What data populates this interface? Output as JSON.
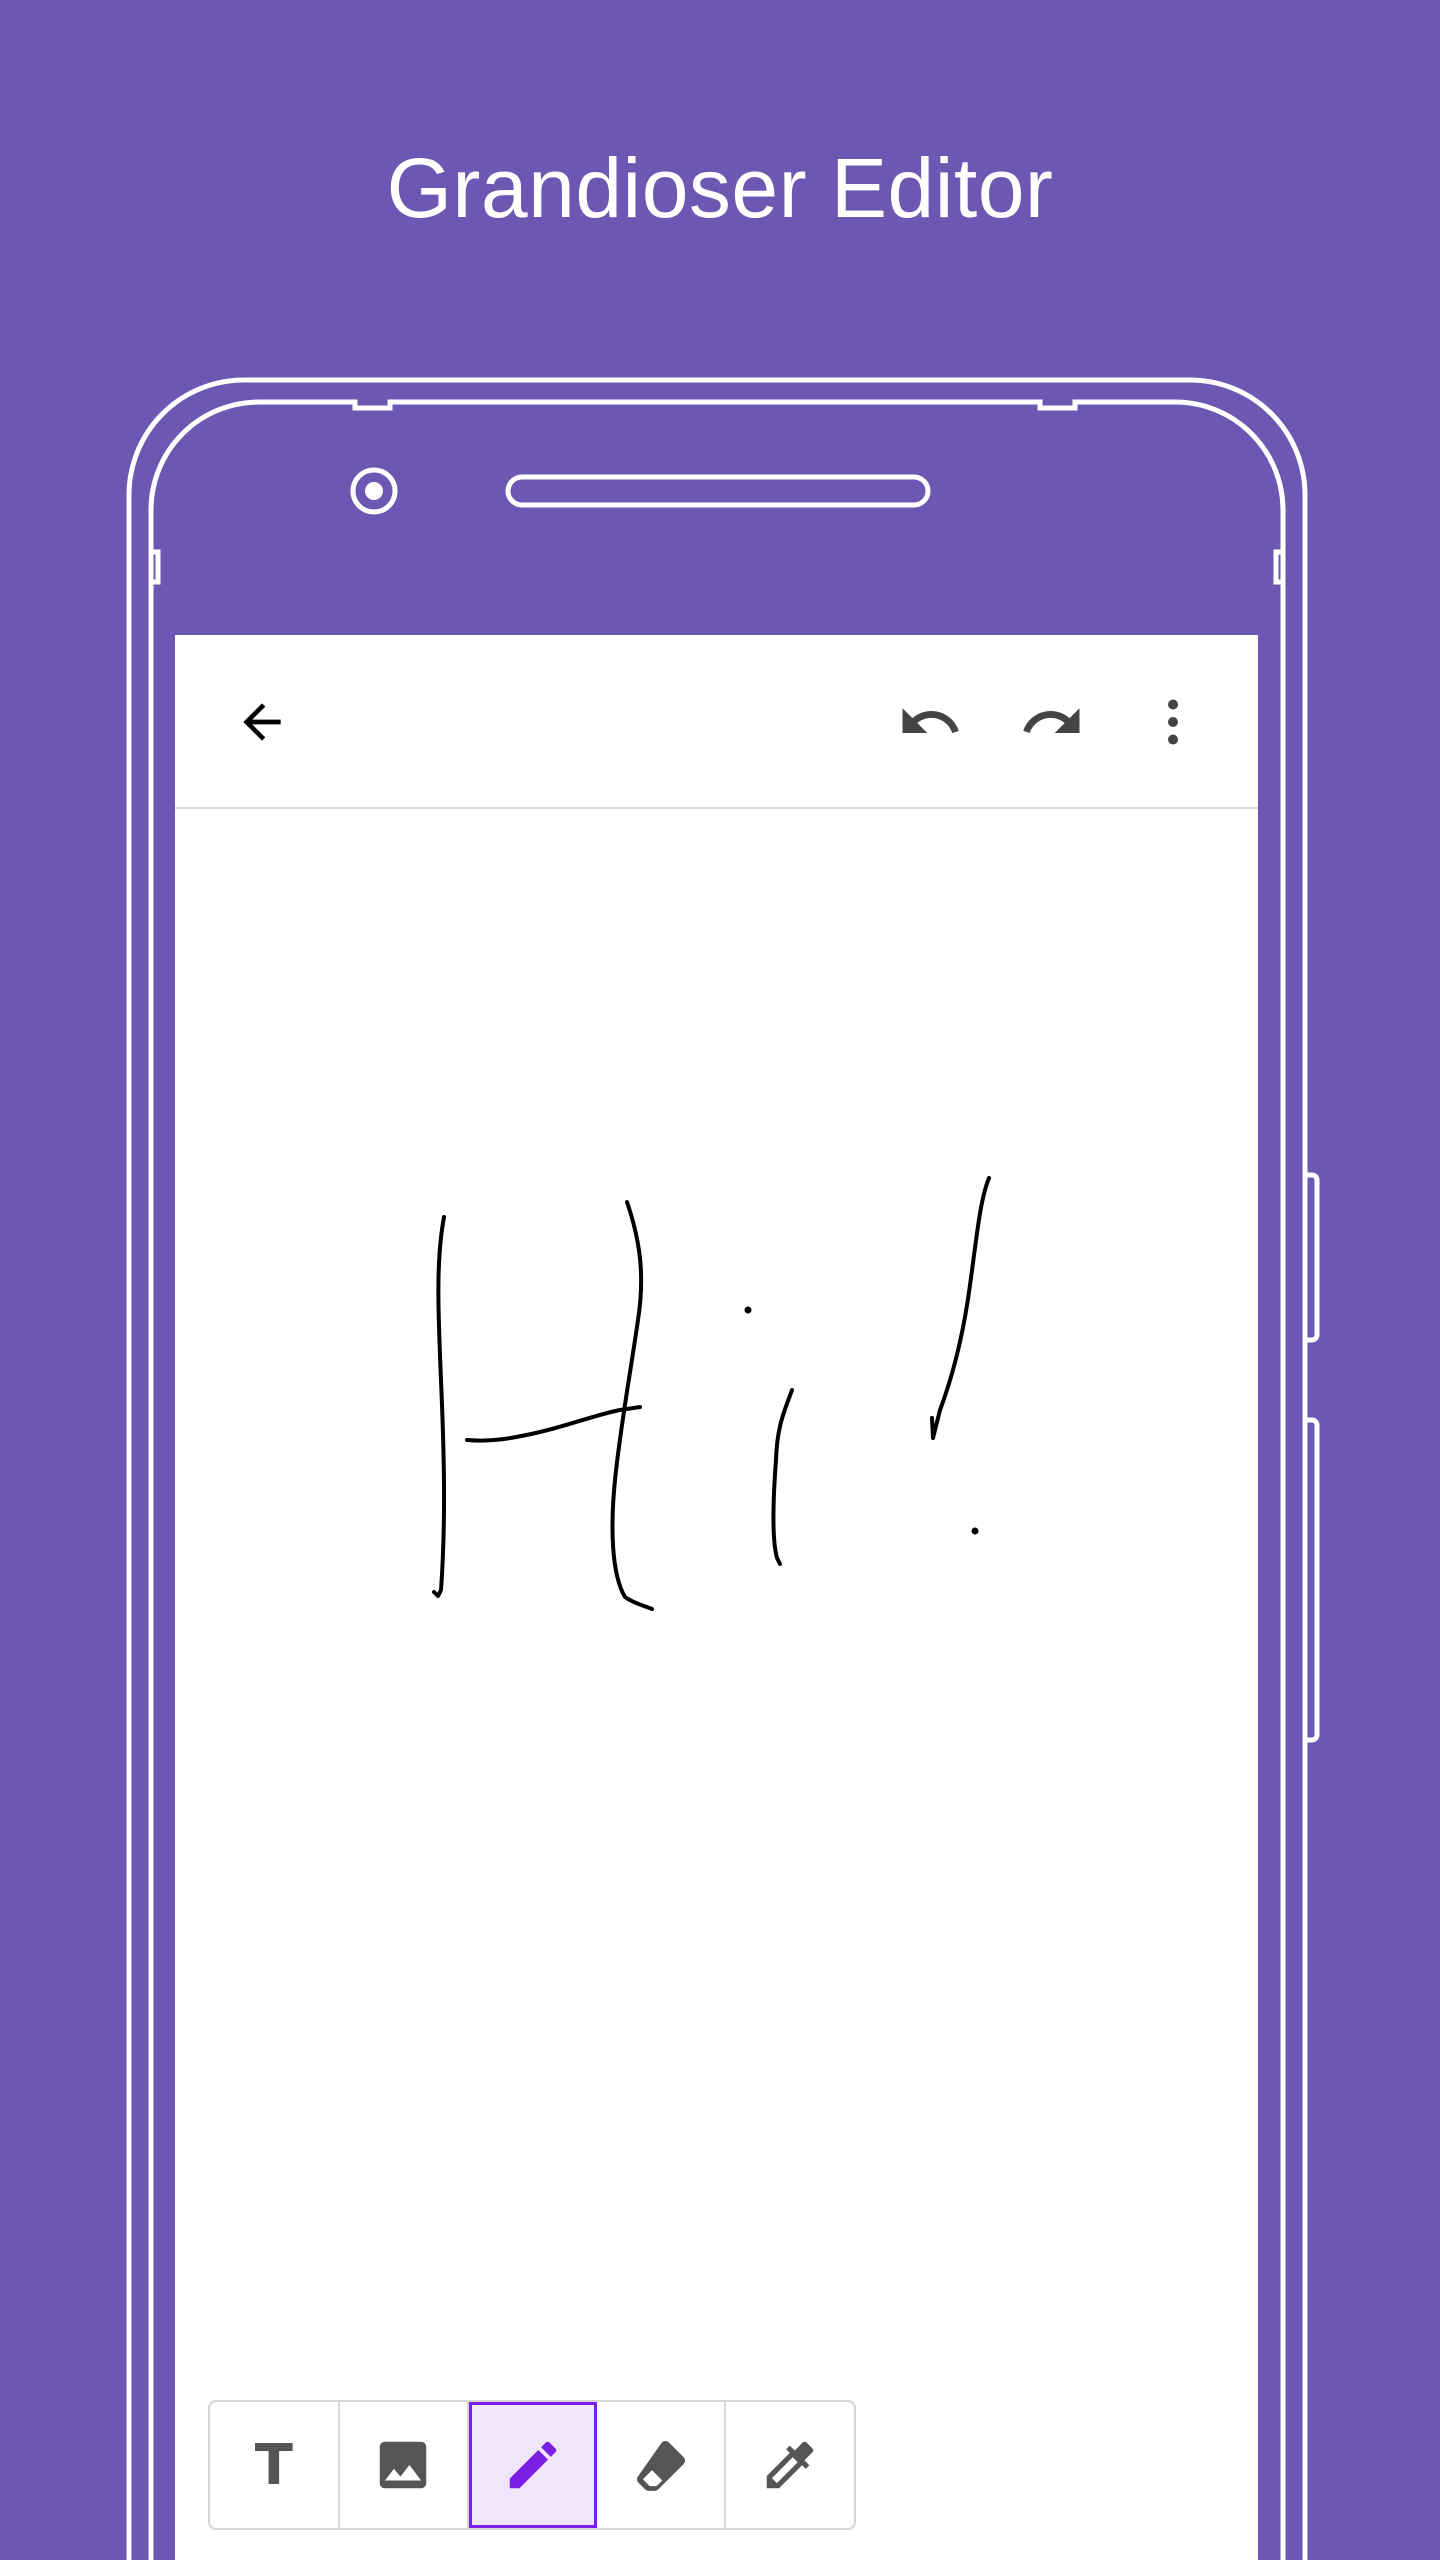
{
  "promo": {
    "title": "Grandioser Editor"
  },
  "app_bar": {
    "back_icon": "arrow-back-icon",
    "undo_icon": "undo-icon",
    "redo_icon": "redo-icon",
    "more_icon": "more-vert-icon"
  },
  "canvas": {
    "drawing_text": "Hi!"
  },
  "toolbar": {
    "tools": [
      {
        "id": "text",
        "icon": "text-icon",
        "glyph": "T",
        "active": false
      },
      {
        "id": "image",
        "icon": "image-icon",
        "active": false
      },
      {
        "id": "pen",
        "icon": "pencil-icon",
        "active": true
      },
      {
        "id": "eraser",
        "icon": "eraser-icon",
        "active": false
      },
      {
        "id": "color-picker",
        "icon": "eyedropper-icon",
        "active": false
      }
    ]
  },
  "colors": {
    "background": "#6c58b2",
    "accent": "#7a1fe8",
    "active_tool_bg": "#efe6fb",
    "icon": "#555555",
    "ink": "#000000"
  }
}
